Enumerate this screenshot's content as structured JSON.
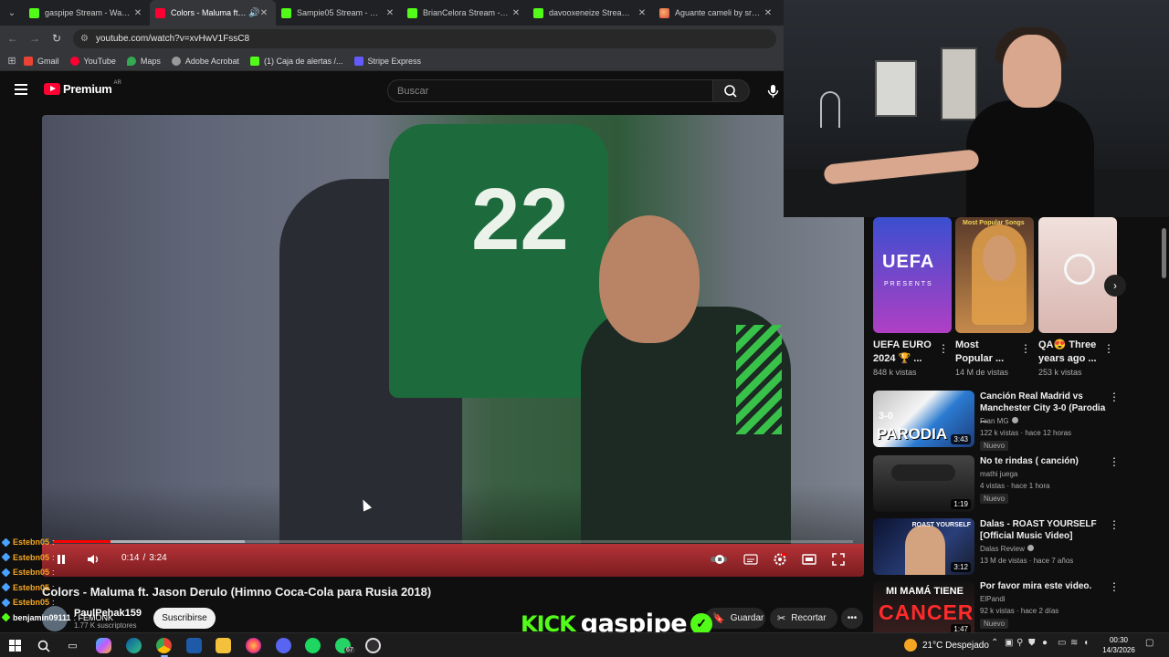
{
  "browser": {
    "tabs": [
      {
        "title": "gaspipe Stream - Watch L",
        "favicon": "kick",
        "active": false
      },
      {
        "title": "Colors - Maluma ft. Ja",
        "favicon": "youtube",
        "active": true
      },
      {
        "title": "Sampie05 Stream - Watch",
        "favicon": "kick",
        "active": false
      },
      {
        "title": "BrianCelora Stream - Watc",
        "favicon": "kick",
        "active": false
      },
      {
        "title": "davooxeneize Stream - W",
        "favicon": "kick",
        "active": false
      },
      {
        "title": "Aguante cameli by sr_apy",
        "favicon": "ball",
        "active": false
      }
    ],
    "url": "youtube.com/watch?v=xvHwV1FssC8",
    "bookmarks": [
      "Gmail",
      "YouTube",
      "Maps",
      "Adobe Acrobat",
      "(1) Caja de alertas /...",
      "Stripe Express"
    ]
  },
  "youtube": {
    "logo": "Premium",
    "country": "AR",
    "search_placeholder": "Buscar"
  },
  "player": {
    "time_current": "0:14",
    "time_total": "3:24",
    "time_sep": "/",
    "progress": 0.072,
    "buffer": 0.24,
    "jersey_number": "22"
  },
  "video": {
    "title": "Colors - Maluma ft. Jason Derulo (Himno Coca-Cola para Rusia 2018)",
    "channel": "PaulPehak159",
    "subscribers": "1.77 K suscriptores",
    "subscribe_label": "Suscribirse",
    "save_label": "Guardar",
    "clip_label": "Recortar"
  },
  "chat": [
    {
      "user": "Estebn05",
      "msg": ":"
    },
    {
      "user": "Estebn05",
      "msg": ":"
    },
    {
      "user": "Estebn05",
      "msg": ":"
    },
    {
      "user": "Estebn05",
      "msg": ":"
    },
    {
      "user": "Estebn05",
      "msg": ":"
    },
    {
      "user": "benjamin09111",
      "msg": ": FEMONK"
    }
  ],
  "overlay": {
    "kick_logo": "KICK",
    "streamer": "gaspipe",
    "check": "✓"
  },
  "shorts": [
    {
      "thumb_text": "UEFA",
      "thumb_sub": "PRESENTS",
      "title": "UEFA EURO 2024 🏆 ...",
      "views": "848 k vistas"
    },
    {
      "thumb_text": "Most Popular Songs",
      "title": "Most Popular ...",
      "views": "14 M de vistas"
    },
    {
      "title": "QA😍 Three years ago ...",
      "views": "253 k vistas"
    }
  ],
  "recommendations": [
    {
      "title": "Canción Real Madrid vs Manchester City 3-0 (Parodia ...",
      "channel": "Fran MG",
      "verified": true,
      "meta": "122 k vistas · hace 12 horas",
      "new": "Nuevo",
      "duration": "3:43",
      "thumb_big": "PARODIA",
      "thumb_score": "3-0"
    },
    {
      "title": "No te rindas ( canción)",
      "channel": "mathi juega",
      "verified": false,
      "meta": "4 vistas · hace 1 hora",
      "new": "Nuevo",
      "duration": "1:19"
    },
    {
      "title": "Dalas - ROAST YOURSELF [Official Music Video]",
      "channel": "Dalas Review",
      "verified": true,
      "meta": "13 M de vistas · hace 7 años",
      "new": "",
      "duration": "3:12",
      "thumb_cap": "ROAST YOURSELF"
    },
    {
      "title": "Por favor mira este video.",
      "channel": "ElPandi",
      "verified": false,
      "meta": "92 k vistas · hace 2 días",
      "new": "Nuevo",
      "duration": "1:47",
      "thumb_line1": "MI MAMÁ TIENE",
      "thumb_line2": "CANCER"
    }
  ],
  "taskbar": {
    "weather": "21°C Despejado",
    "time": "00:30",
    "date": "14/3/2026",
    "whatsapp_badge": "67"
  },
  "colors": {
    "youtube_red": "#ff0033",
    "kick_green": "#53fc18",
    "chat_user": "#f5a623"
  }
}
